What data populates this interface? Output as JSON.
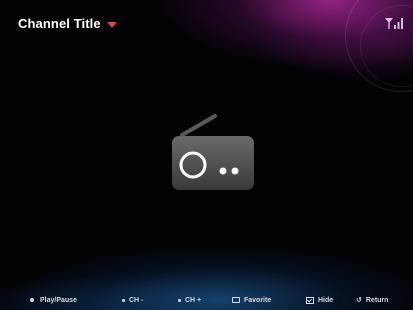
{
  "header": {
    "channel_title": "Channel Title"
  },
  "icons": {
    "title_dropdown": "chevron-down-icon",
    "signal": "signal-strength-icon",
    "media": "radio-icon"
  },
  "colors": {
    "caret": "#e0405c",
    "background": "#030306",
    "text": "#ffffff",
    "footer_text": "#d8dbe6",
    "glow_top": "#aa2896",
    "glow_bottom": "#19558c",
    "radio_body": "#4a4a4a"
  },
  "footer": {
    "play_pause": "Play/Pause",
    "ch_down": "CH -",
    "ch_up": "CH +",
    "favorite": "Favorite",
    "hide": "Hide",
    "return": "Return"
  }
}
